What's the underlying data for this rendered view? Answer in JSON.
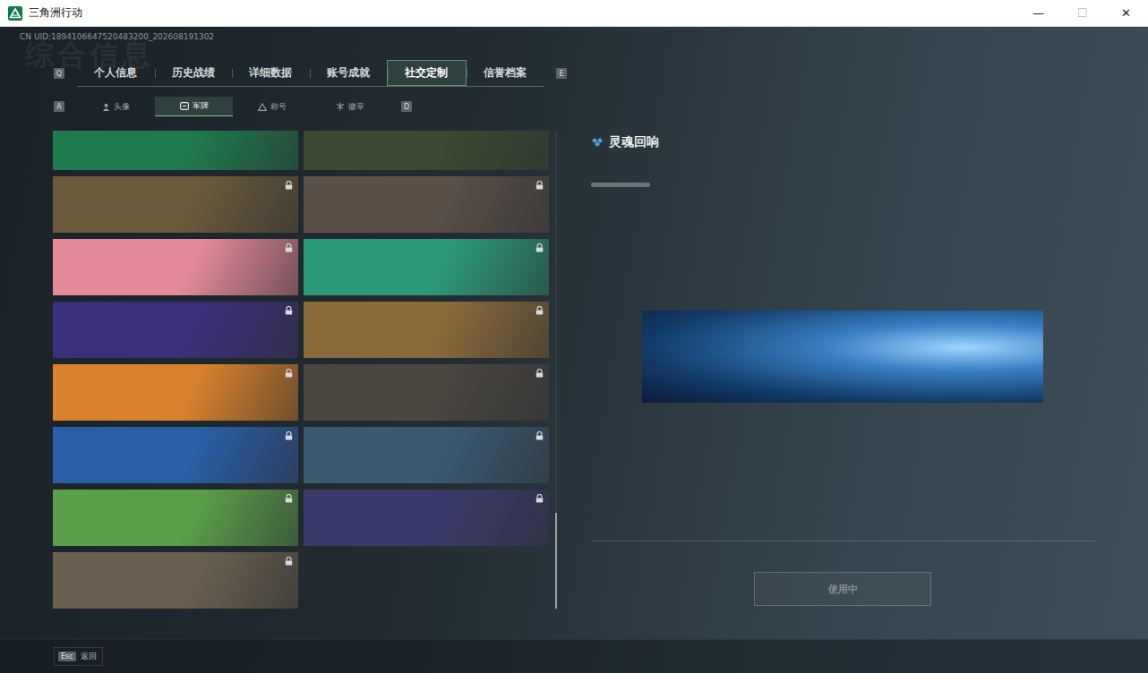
{
  "window": {
    "title": "三角洲行动",
    "controls": [
      {
        "label": "—",
        "disabled": false
      },
      {
        "label": "☐",
        "disabled": true
      },
      {
        "label": "✕",
        "disabled": false
      }
    ]
  },
  "uid": "CN UID:1894106647520483200_202608191302",
  "watermark": "综合信息",
  "tabs": {
    "prev_key": "Q",
    "next_key": "E",
    "items": [
      {
        "label": "个人信息",
        "selected": false
      },
      {
        "label": "历史战绩",
        "selected": false
      },
      {
        "label": "详细数据",
        "selected": false
      },
      {
        "label": "账号成就",
        "selected": false
      },
      {
        "label": "社交定制",
        "selected": true
      },
      {
        "label": "信誉档案",
        "selected": false
      }
    ]
  },
  "subtabs": {
    "prev_key": "A",
    "next_key": "D",
    "items": [
      {
        "label": "头像",
        "selected": false,
        "kind": "avatar"
      },
      {
        "label": "军牌",
        "selected": true,
        "kind": "tag"
      },
      {
        "label": "称号",
        "selected": false,
        "kind": "title"
      },
      {
        "label": "徽章",
        "selected": false,
        "kind": "badge"
      }
    ]
  },
  "cards": [
    {
      "color": "#1f7a4e",
      "locked": false
    },
    {
      "color": "#3b4a30",
      "locked": false
    },
    {
      "color": "#6b5a3a",
      "locked": true
    },
    {
      "color": "#5a5048",
      "locked": true
    },
    {
      "color": "#e58a9a",
      "locked": true
    },
    {
      "color": "#2d9a7a",
      "locked": true
    },
    {
      "color": "#3a2f7a",
      "locked": true
    },
    {
      "color": "#8a6a3a",
      "locked": true
    },
    {
      "color": "#d9822b",
      "locked": true
    },
    {
      "color": "#4a4640",
      "locked": true
    },
    {
      "color": "#2a5fa8",
      "locked": true
    },
    {
      "color": "#3a5a72",
      "locked": true
    },
    {
      "color": "#5aa04a",
      "locked": true
    },
    {
      "color": "#3a3a6a",
      "locked": true
    },
    {
      "color": "#6a6050",
      "locked": true
    }
  ],
  "scrollbar": {
    "level": 1
  },
  "detail": {
    "title": "灵魂回响",
    "button": {
      "label": "使用中",
      "disabled": true
    }
  },
  "footer": {
    "key": "Esc",
    "label": "返回"
  }
}
